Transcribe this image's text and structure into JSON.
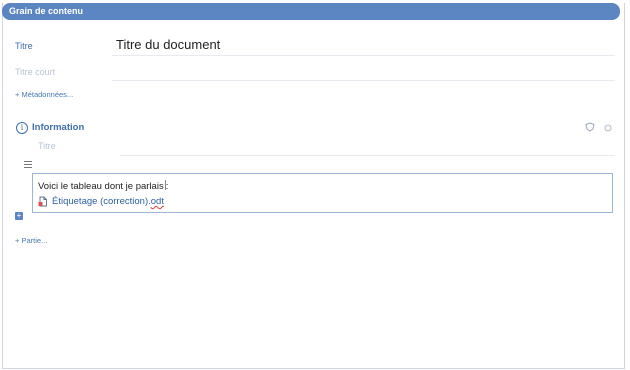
{
  "header": {
    "title": "Grain de contenu"
  },
  "fields": {
    "title_label": "Titre",
    "title_value": "Titre du document",
    "short_title_label": "Titre court",
    "metadata_link": "+ Métadonnées..."
  },
  "section": {
    "label": "Information",
    "title_placeholder": "Titre"
  },
  "editor": {
    "text": "Voici le tableau dont je parlais",
    "text_after_cursor": ":",
    "attachment_prefix": "Étiquetage (correction).",
    "attachment_ext": "odt"
  },
  "add_part_link": "+ Partie...",
  "colors": {
    "header_bg": "#5b86c1",
    "label": "#3f6fae",
    "link": "#2d5ea3",
    "editor_border": "#9db6d8"
  },
  "icons": {
    "info": "info-circle-icon",
    "shield": "shield-icon",
    "circle": "circle-icon",
    "drag": "drag-handle-icon",
    "file": "document-file-icon",
    "add": "plus-icon"
  }
}
